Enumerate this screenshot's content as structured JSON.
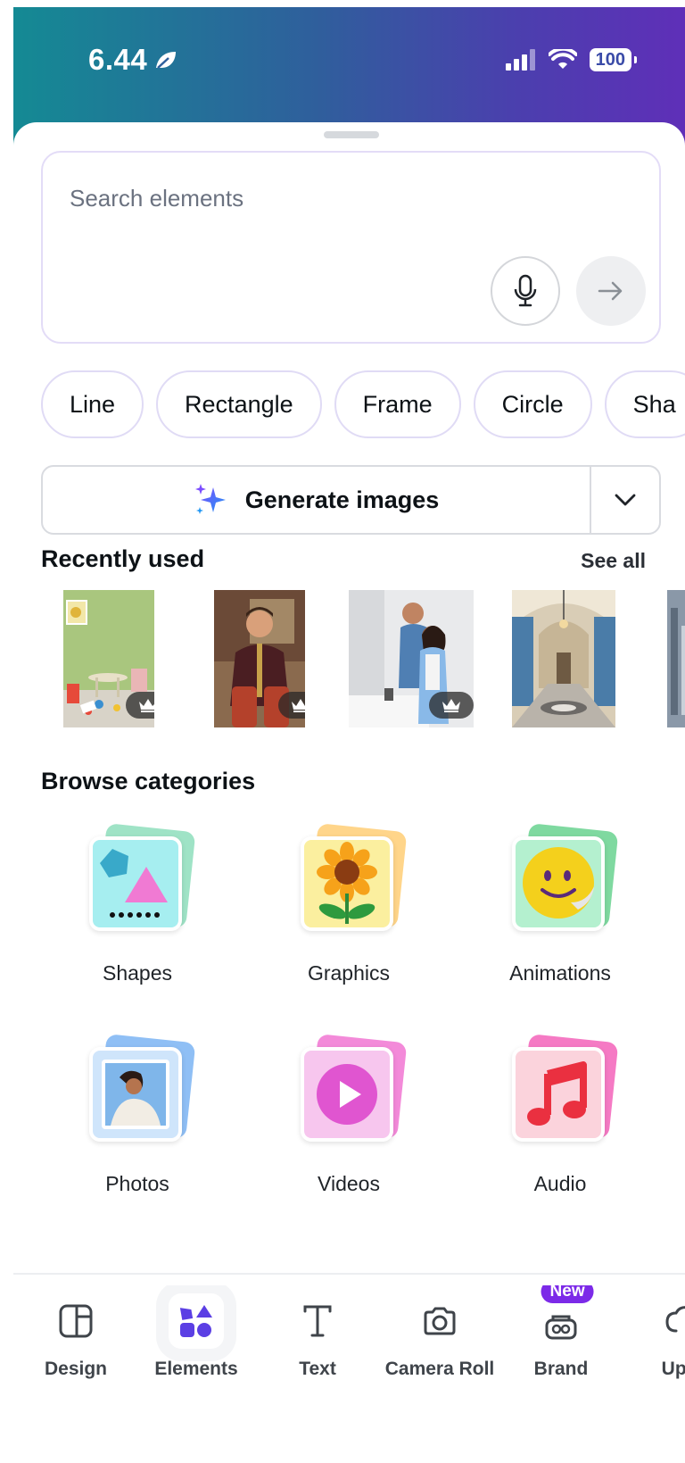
{
  "status_bar": {
    "time": "6.44",
    "battery": "100"
  },
  "search": {
    "placeholder": "Search elements"
  },
  "chips": [
    "Line",
    "Rectangle",
    "Frame",
    "Circle",
    "Sha"
  ],
  "generate": {
    "label": "Generate images"
  },
  "recent": {
    "title": "Recently used",
    "see_all": "See all"
  },
  "browse": {
    "title": "Browse categories",
    "categories": [
      {
        "label": "Shapes",
        "icon": "shapes-icon"
      },
      {
        "label": "Graphics",
        "icon": "sunflower-icon"
      },
      {
        "label": "Animations",
        "icon": "smiley-sticker-icon"
      },
      {
        "label": "Photos",
        "icon": "photo-icon"
      },
      {
        "label": "Videos",
        "icon": "play-icon"
      },
      {
        "label": "Audio",
        "icon": "music-note-icon"
      }
    ]
  },
  "tabbar": {
    "items": [
      {
        "label": "Design",
        "icon": "layout-icon"
      },
      {
        "label": "Elements",
        "icon": "elements-icon",
        "active": true
      },
      {
        "label": "Text",
        "icon": "text-icon"
      },
      {
        "label": "Camera Roll",
        "icon": "camera-icon"
      },
      {
        "label": "Brand",
        "icon": "brand-icon",
        "badge": "New"
      },
      {
        "label": "Uplo",
        "icon": "upload-icon"
      }
    ]
  },
  "colors": {
    "accent": "#7c2ae8",
    "chip_border": "#e0dbf5",
    "gradient_start": "#148a94",
    "gradient_end": "#5f2fb8"
  }
}
